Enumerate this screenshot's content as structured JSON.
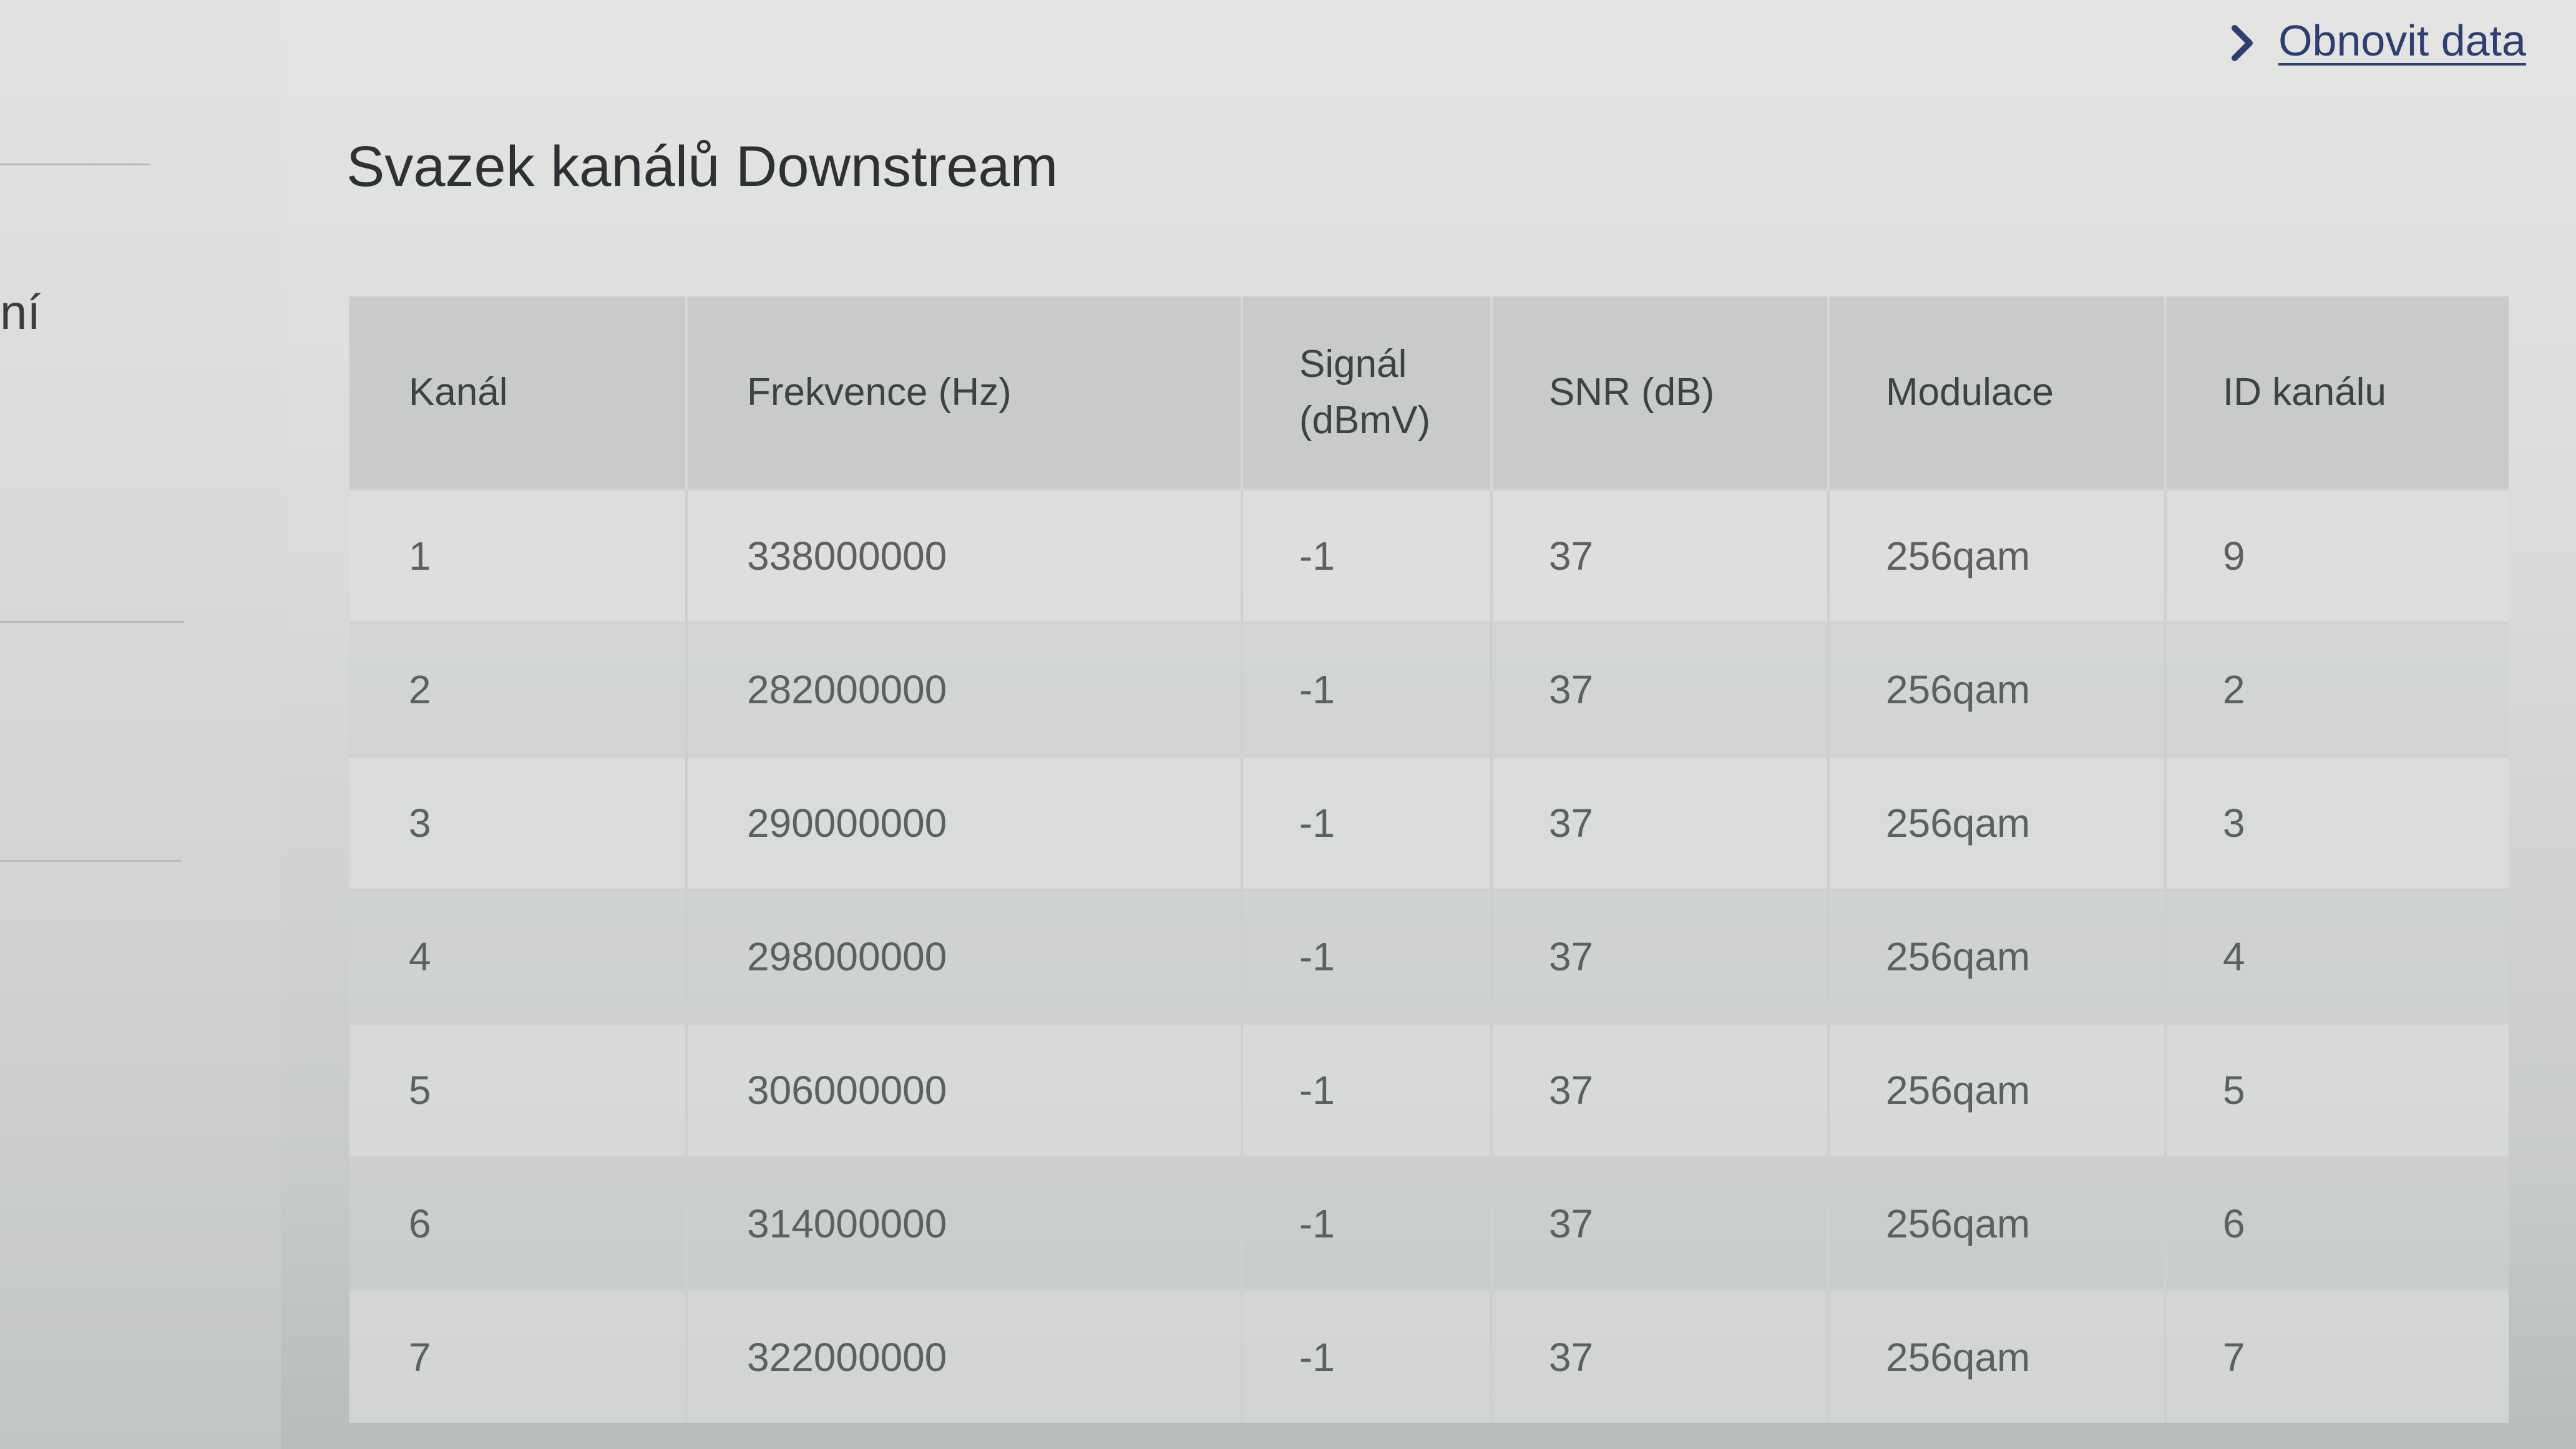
{
  "sidebar": {
    "fragment_text": "ní"
  },
  "header": {
    "refresh_link": "Obnovit data",
    "title": "Svazek kanálů Downstream"
  },
  "icons": {
    "refresh_chevron": "chevron-right-icon"
  },
  "colors": {
    "link": "#2c3e73",
    "header_bg": "#c9cbca"
  },
  "table": {
    "headers": {
      "channel": "Kanál",
      "frequency": "Frekvence (Hz)",
      "signal_line1": "Signál",
      "signal_line2": "(dBmV)",
      "snr": "SNR (dB)",
      "modulation": "Modulace",
      "channel_id": "ID kanálu"
    },
    "rows": [
      {
        "channel": "1",
        "frequency": "338000000",
        "signal": "-1",
        "snr": "37",
        "modulation": "256qam",
        "channel_id": "9"
      },
      {
        "channel": "2",
        "frequency": "282000000",
        "signal": "-1",
        "snr": "37",
        "modulation": "256qam",
        "channel_id": "2"
      },
      {
        "channel": "3",
        "frequency": "290000000",
        "signal": "-1",
        "snr": "37",
        "modulation": "256qam",
        "channel_id": "3"
      },
      {
        "channel": "4",
        "frequency": "298000000",
        "signal": "-1",
        "snr": "37",
        "modulation": "256qam",
        "channel_id": "4"
      },
      {
        "channel": "5",
        "frequency": "306000000",
        "signal": "-1",
        "snr": "37",
        "modulation": "256qam",
        "channel_id": "5"
      },
      {
        "channel": "6",
        "frequency": "314000000",
        "signal": "-1",
        "snr": "37",
        "modulation": "256qam",
        "channel_id": "6"
      },
      {
        "channel": "7",
        "frequency": "322000000",
        "signal": "-1",
        "snr": "37",
        "modulation": "256qam",
        "channel_id": "7"
      }
    ]
  }
}
